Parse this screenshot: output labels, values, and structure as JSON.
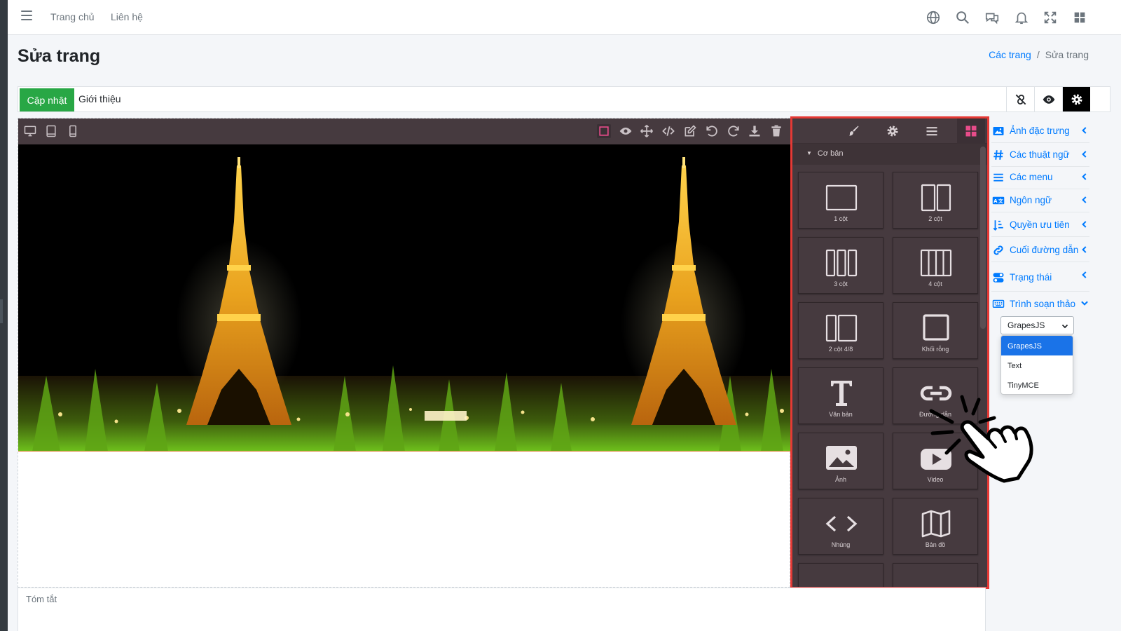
{
  "topbar": {
    "nav": [
      "Trang chủ",
      "Liên hệ"
    ],
    "icons": [
      "globe-icon",
      "search-icon",
      "chat-icon",
      "bell-icon",
      "expand-icon",
      "apps-icon"
    ]
  },
  "page": {
    "title": "Sửa trang",
    "breadcrumb": {
      "link": "Các trang",
      "separator": "/",
      "current": "Sửa trang"
    }
  },
  "title_row": {
    "update_label": "Cập nhật",
    "title_value": "Giới thiệu"
  },
  "blocks_panel": {
    "category": "Cơ bản",
    "blocks": [
      "1 cột",
      "2 cột",
      "3 cột",
      "4 cột",
      "2 cột 4/8",
      "Khối rỗng",
      "Văn bản",
      "Đường dẫn",
      "Ảnh",
      "Video",
      "Nhúng",
      "Bản đồ"
    ]
  },
  "sidebar": {
    "items": [
      {
        "label": "Ảnh đặc trưng",
        "icon": "image-icon"
      },
      {
        "label": "Các thuật ngữ",
        "icon": "hashtag-icon"
      },
      {
        "label": "Các menu",
        "icon": "list-icon"
      },
      {
        "label": "Ngôn ngữ",
        "icon": "language-icon"
      },
      {
        "label": "Quyền ưu tiên",
        "icon": "sort-icon"
      },
      {
        "label": "Cuối đường dẫn",
        "icon": "link-icon"
      },
      {
        "label": "Trạng thái",
        "icon": "toggle-icon"
      },
      {
        "label": "Trình soạn thảo",
        "icon": "keyboard-icon"
      }
    ],
    "editor_select": {
      "value": "GrapesJS",
      "options": [
        "GrapesJS",
        "Text",
        "TinyMCE"
      ]
    }
  },
  "summary_placeholder": "Tóm tắt",
  "colors": {
    "accent": "#007bff",
    "update": "#28a745",
    "panel": "#463a3f",
    "highlight": "#e53935"
  }
}
